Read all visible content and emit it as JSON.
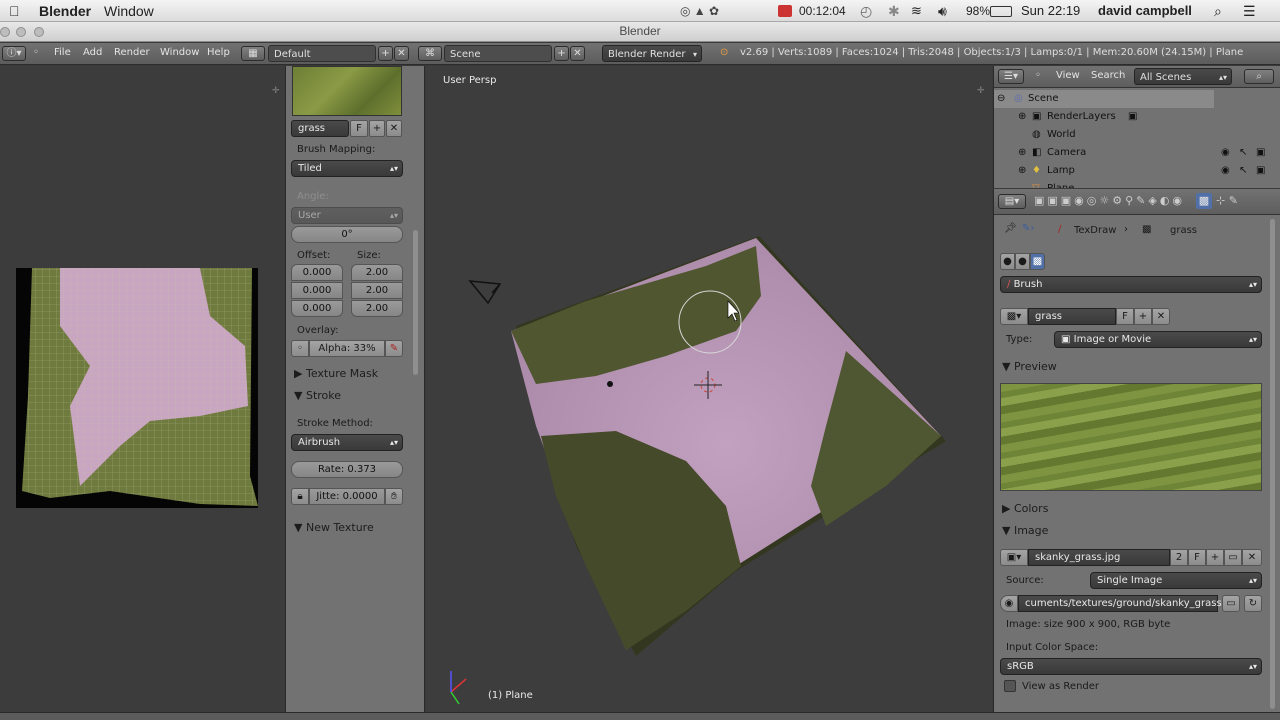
{
  "macbar": {
    "app": "Blender",
    "menu_window": "Window",
    "timer": "00:12:04",
    "battery": "98%",
    "clock": "Sun 22:19",
    "user": "david campbell"
  },
  "window_title": "Blender",
  "infobar": {
    "menus": [
      "File",
      "Add",
      "Render",
      "Window",
      "Help"
    ],
    "layout": "Default",
    "scene": "Scene",
    "engine": "Blender Render",
    "stats": "v2.69 | Verts:1089 | Faces:1024 | Tris:2048 | Objects:1/3 | Lamps:0/1 | Mem:20.60M (24.15M) | Plane"
  },
  "toolpanel": {
    "texture_name": "grass",
    "fake_user": "F",
    "brush_mapping_label": "Brush Mapping:",
    "brush_mapping_value": "Tiled",
    "angle_label": "Angle:",
    "angle_mode": "User",
    "angle_value": "0°",
    "offset_label": "Offset:",
    "size_label": "Size:",
    "offset_values": [
      "0.000",
      "0.000",
      "0.000"
    ],
    "size_values": [
      "2.00",
      "2.00",
      "2.00"
    ],
    "overlay_label": "Overlay:",
    "overlay_alpha": "Alpha: 33%",
    "texture_mask": "Texture Mask",
    "stroke": "Stroke",
    "stroke_method_label": "Stroke Method:",
    "stroke_method": "Airbrush",
    "rate": "Rate: 0.373",
    "jitter": "Jitte: 0.0000",
    "new_texture": "New Texture"
  },
  "viewport": {
    "view_name": "User Persp",
    "object_label": "(1) Plane"
  },
  "outliner": {
    "view": "View",
    "search": "Search",
    "filter": "All Scenes",
    "items": [
      "Scene",
      "RenderLayers",
      "World",
      "Camera",
      "Lamp",
      "Plane"
    ]
  },
  "properties": {
    "breadcrumb_mode": "TexDraw",
    "breadcrumb_tex": "grass",
    "brush": "Brush",
    "texture": "grass",
    "fake": "F",
    "type_label": "Type:",
    "type_value": "Image or Movie",
    "preview": "Preview",
    "colors": "Colors",
    "image": "Image",
    "image_name": "skanky_grass.jpg",
    "image_users": "2",
    "image_fake": "F",
    "source_label": "Source:",
    "source_value": "Single Image",
    "filepath": "cuments/textures/ground/skanky_grass.jpg",
    "image_info": "Image: size 900 x 900, RGB byte",
    "color_space_label": "Input Color Space:",
    "color_space": "sRGB",
    "view_as_render": "View as Render"
  }
}
